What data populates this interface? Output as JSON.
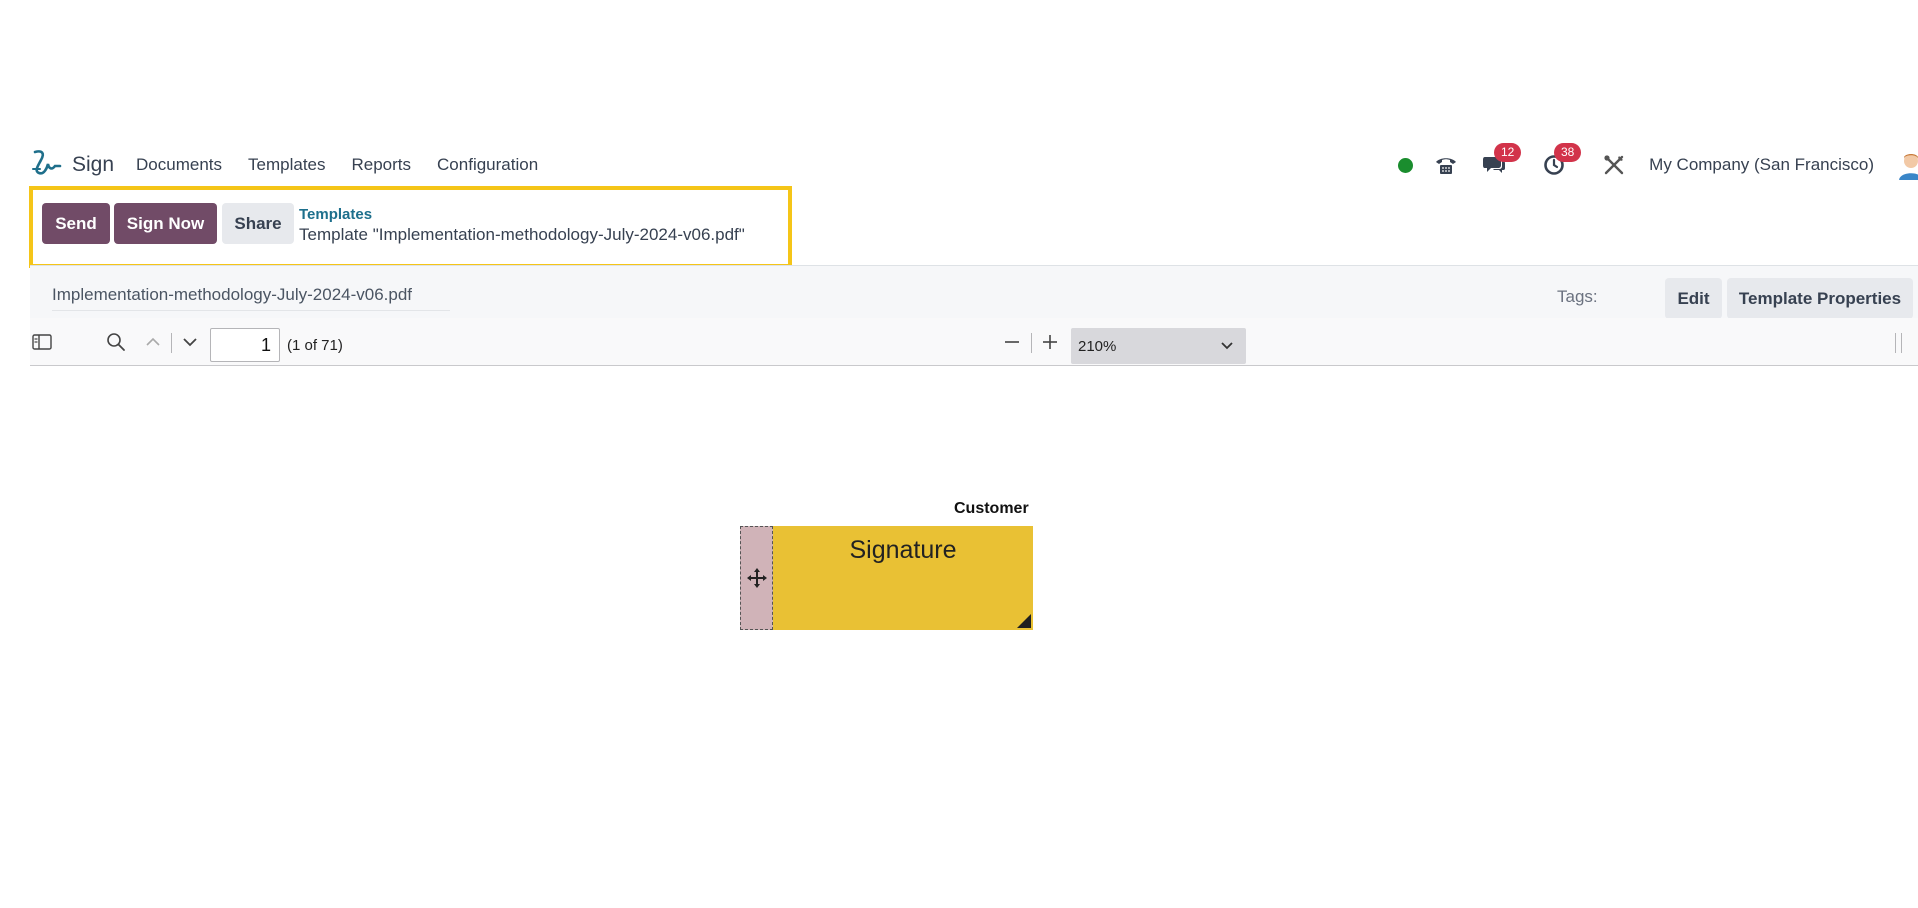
{
  "navbar": {
    "app_name": "Sign",
    "menu": [
      "Documents",
      "Templates",
      "Reports",
      "Configuration"
    ],
    "messages_count": "12",
    "activities_count": "38",
    "company": "My Company (San Francisco)",
    "presence_color": "#1a8d2e"
  },
  "control_panel": {
    "send_label": "Send",
    "sign_now_label": "Sign Now",
    "share_label": "Share",
    "breadcrumb_parent": "Templates",
    "breadcrumb_current": "Template \"Implementation-methodology-July-2024-v06.pdf\""
  },
  "document_bar": {
    "file_name": "Implementation-methodology-July-2024-v06.pdf",
    "tags_label": "Tags:",
    "edit_label": "Edit",
    "properties_label": "Template Properties"
  },
  "pdf_toolbar": {
    "page_number": "1",
    "page_count": "(1 of 71)",
    "zoom": "210%"
  },
  "document": {
    "role": "Customer",
    "field_label": "Signature"
  },
  "colors": {
    "primary": "#714b67",
    "highlight": "#f5c518",
    "signature_field": "#e9c134",
    "badge": "#d2334a"
  }
}
